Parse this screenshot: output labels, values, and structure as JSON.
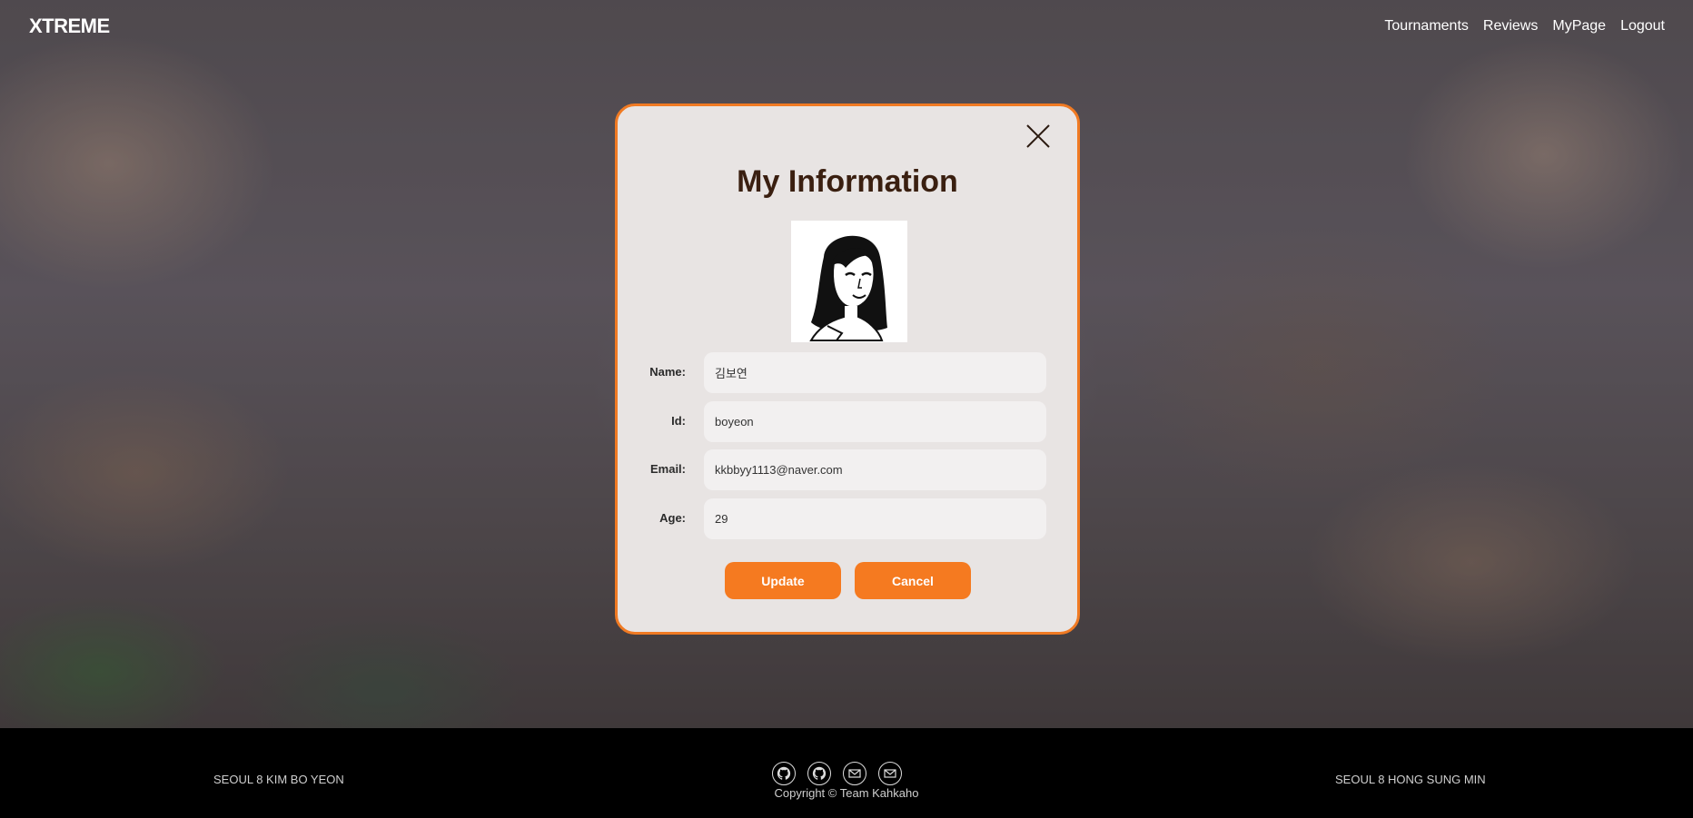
{
  "header": {
    "logo": "XTREME",
    "nav": [
      "Tournaments",
      "Reviews",
      "MyPage",
      "Logout"
    ]
  },
  "modal": {
    "title": "My Information",
    "fields": [
      {
        "label": "Name:",
        "value": "김보연"
      },
      {
        "label": "Id:",
        "value": "boyeon"
      },
      {
        "label": "Email:",
        "value": "kkbbyy1113@naver.com"
      },
      {
        "label": "Age:",
        "value": "29"
      }
    ],
    "update_label": "Update",
    "cancel_label": "Cancel"
  },
  "footer": {
    "left": "SEOUL 8 KIM BO YEON",
    "right": "SEOUL 8 HONG SUNG MIN",
    "copyright": "Copyright © Team Kahkaho",
    "icons": [
      "github-icon",
      "github-icon",
      "mail-icon",
      "mail-icon"
    ]
  },
  "colors": {
    "accent": "#f57a20",
    "modal_bg": "#e8e4e3",
    "title": "#3a1f10",
    "footer_bg": "#000000"
  }
}
